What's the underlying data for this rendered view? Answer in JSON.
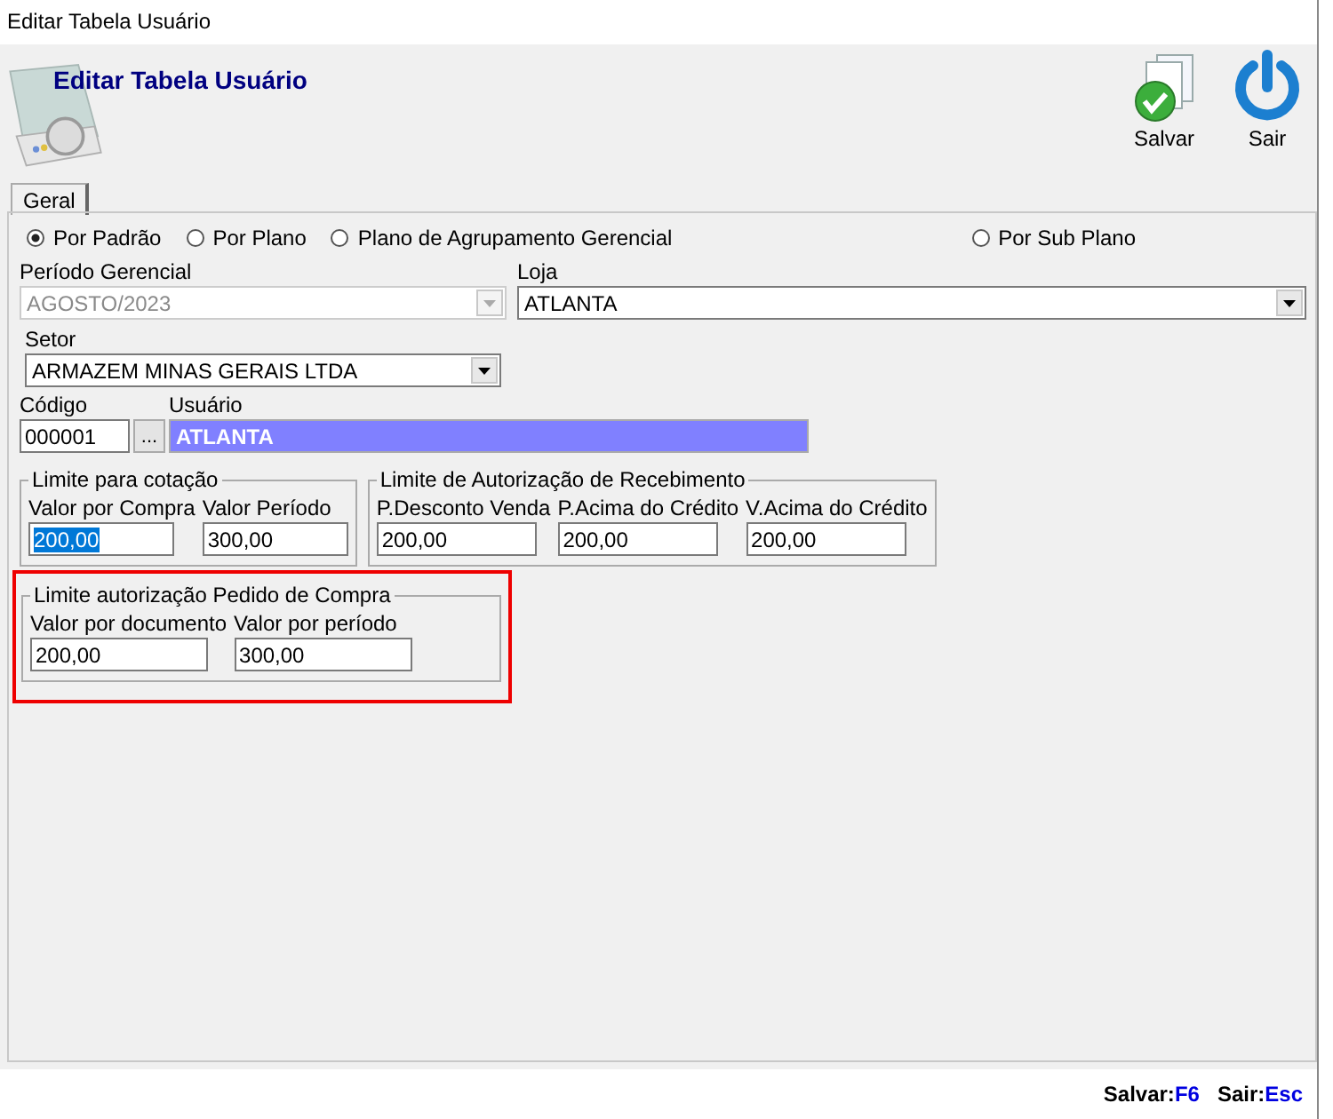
{
  "window": {
    "title": "Editar Tabela Usuário"
  },
  "header": {
    "title": "Editar Tabela Usuário",
    "buttons": [
      {
        "label": "Salvar",
        "kind": "save"
      },
      {
        "label": "Sair",
        "kind": "exit"
      }
    ]
  },
  "tabs": [
    {
      "label": "Geral",
      "selected": true
    }
  ],
  "radios": [
    {
      "label": "Por Padrão",
      "selected": true
    },
    {
      "label": "Por Plano",
      "selected": false
    },
    {
      "label": "Plano de Agrupamento Gerencial",
      "selected": false
    },
    {
      "label": "Por Sub Plano",
      "selected": false
    }
  ],
  "periodo": {
    "label": "Período Gerencial",
    "value": "AGOSTO/2023",
    "disabled": true
  },
  "loja": {
    "label": "Loja",
    "value": "ATLANTA",
    "disabled": false
  },
  "setor": {
    "label": "Setor",
    "value": "ARMAZEM MINAS GERAIS LTDA",
    "disabled": false
  },
  "codigo": {
    "label": "Código",
    "value": "000001",
    "button": "..."
  },
  "usuario": {
    "label": "Usuário",
    "value": "ATLANTA"
  },
  "groups": [
    {
      "title": "Limite para cotação",
      "highlighted": false,
      "fields": [
        {
          "label": "Valor por Compra",
          "value": "200,00",
          "text_selected": true
        },
        {
          "label": "Valor Período",
          "value": "300,00",
          "text_selected": false
        }
      ]
    },
    {
      "title": "Limite de Autorização de Recebimento",
      "highlighted": false,
      "fields": [
        {
          "label": "P.Desconto Venda",
          "value": "200,00",
          "text_selected": false
        },
        {
          "label": "P.Acima  do Crédito",
          "value": "200,00",
          "text_selected": false
        },
        {
          "label": "V.Acima  do Crédito",
          "value": "200,00",
          "text_selected": false
        }
      ]
    },
    {
      "title": "Limite autorização Pedido de Compra",
      "highlighted": true,
      "fields": [
        {
          "label": "Valor por documento",
          "value": "200,00",
          "text_selected": false
        },
        {
          "label": "Valor por período",
          "value": "300,00",
          "text_selected": false
        }
      ]
    }
  ],
  "status_bar": [
    {
      "label": "Salvar:",
      "key": "F6"
    },
    {
      "label": "Sair:",
      "key": "Esc"
    }
  ]
}
